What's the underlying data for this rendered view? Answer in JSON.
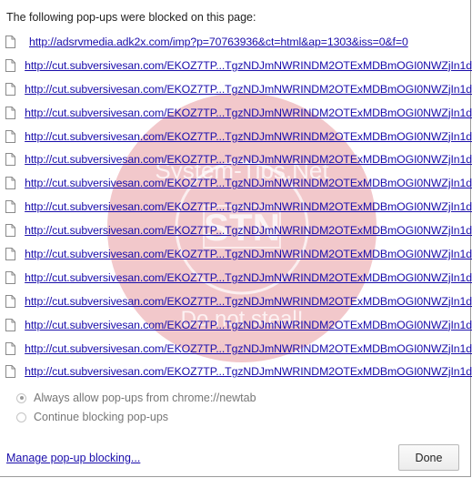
{
  "title": "The following pop-ups were blocked on this page:",
  "blocked_popups": [
    {
      "url": "http://adsrvmedia.adk2x.com/imp?p=70763936&ct=html&ap=1303&iss=0&f=0"
    },
    {
      "url": "http://cut.subversivesan.com/EKOZ7TP...TgzNDJmNWRINDM2OTExMDBmOGI0NWZjIn1d"
    },
    {
      "url": "http://cut.subversivesan.com/EKOZ7TP...TgzNDJmNWRINDM2OTExMDBmOGI0NWZjIn1d"
    },
    {
      "url": "http://cut.subversivesan.com/EKOZ7TP...TgzNDJmNWRINDM2OTExMDBmOGI0NWZjIn1d"
    },
    {
      "url": "http://cut.subversivesan.com/EKOZ7TP...TgzNDJmNWRINDM2OTExMDBmOGI0NWZjIn1d"
    },
    {
      "url": "http://cut.subversivesan.com/EKOZ7TP...TgzNDJmNWRINDM2OTExMDBmOGI0NWZjIn1d"
    },
    {
      "url": "http://cut.subversivesan.com/EKOZ7TP...TgzNDJmNWRINDM2OTExMDBmOGI0NWZjIn1d"
    },
    {
      "url": "http://cut.subversivesan.com/EKOZ7TP...TgzNDJmNWRINDM2OTExMDBmOGI0NWZjIn1d"
    },
    {
      "url": "http://cut.subversivesan.com/EKOZ7TP...TgzNDJmNWRINDM2OTExMDBmOGI0NWZjIn1d"
    },
    {
      "url": "http://cut.subversivesan.com/EKOZ7TP...TgzNDJmNWRINDM2OTExMDBmOGI0NWZjIn1d"
    },
    {
      "url": "http://cut.subversivesan.com/EKOZ7TP...TgzNDJmNWRINDM2OTExMDBmOGI0NWZjIn1d"
    },
    {
      "url": "http://cut.subversivesan.com/EKOZ7TP...TgzNDJmNWRINDM2OTExMDBmOGI0NWZjIn1d"
    },
    {
      "url": "http://cut.subversivesan.com/EKOZ7TP...TgzNDJmNWRINDM2OTExMDBmOGI0NWZjIn1d"
    },
    {
      "url": "http://cut.subversivesan.com/EKOZ7TP...TgzNDJmNWRINDM2OTExMDBmOGI0NWZjIn1d"
    },
    {
      "url": "http://cut.subversivesan.com/EKOZ7TP...TgzNDJmNWRINDM2OTExMDBmOGI0NWZjIn1d"
    }
  ],
  "options": {
    "allow_label": "Always allow pop-ups from chrome://newtab",
    "block_label": "Continue blocking pop-ups",
    "selected": "allow"
  },
  "footer": {
    "manage_label": "Manage pop-up blocking...",
    "done_label": "Done"
  },
  "watermark": {
    "text_top": "System-Tips.Net",
    "text_center": "STN",
    "text_bottom": "Do not steal!",
    "color": "#d9606a"
  },
  "colors": {
    "link": "#1a0dab",
    "text": "#222222",
    "muted": "#777777"
  },
  "icons": {
    "row_icon": "file-icon",
    "radio_selected": "radio-selected-icon"
  }
}
